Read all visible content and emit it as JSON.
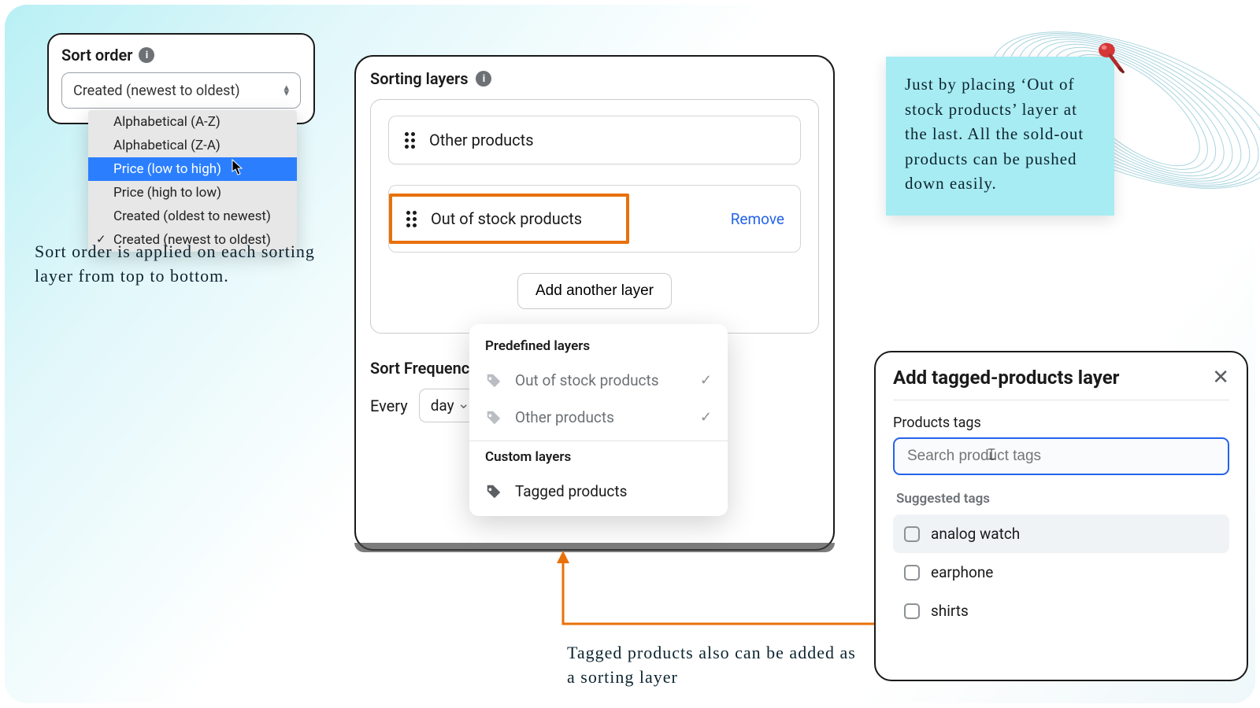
{
  "sort_order": {
    "title": "Sort order",
    "selected": "Created (newest to oldest)",
    "options": [
      {
        "label": "Alphabetical (A-Z)",
        "highlighted": false,
        "checked": false
      },
      {
        "label": "Alphabetical (Z-A)",
        "highlighted": false,
        "checked": false
      },
      {
        "label": "Price (low to high)",
        "highlighted": true,
        "checked": false
      },
      {
        "label": "Price (high to low)",
        "highlighted": false,
        "checked": false
      },
      {
        "label": "Created (oldest to newest)",
        "highlighted": false,
        "checked": false
      },
      {
        "label": "Created (newest to oldest)",
        "highlighted": false,
        "checked": true
      }
    ]
  },
  "annotations": {
    "sort_order": "Sort order is applied on each sorting layer from top to bottom.",
    "tagged": "Tagged products also can be added as a sorting layer",
    "sticky": "Just by placing ‘Out of stock products’ layer at the last. All the sold-out products can be pushed down easily."
  },
  "sorting_layers": {
    "title": "Sorting layers",
    "layers": [
      {
        "name": "Other products"
      },
      {
        "name": "Out of stock products"
      }
    ],
    "remove_label": "Remove",
    "add_button": "Add another layer"
  },
  "sort_frequency": {
    "label": "Sort Frequency",
    "every": "Every",
    "value": "day"
  },
  "popover": {
    "predefined_title": "Predefined layers",
    "predefined": [
      {
        "label": "Out of stock products",
        "added": true
      },
      {
        "label": "Other products",
        "added": true
      }
    ],
    "custom_title": "Custom layers",
    "custom": [
      {
        "label": "Tagged products"
      }
    ]
  },
  "modal": {
    "title": "Add tagged-products layer",
    "field_label": "Products tags",
    "placeholder": "Search product tags",
    "suggested_title": "Suggested tags",
    "tags": [
      {
        "label": "analog watch",
        "highlight": true
      },
      {
        "label": "earphone",
        "highlight": false
      },
      {
        "label": "shirts",
        "highlight": false
      }
    ]
  },
  "colors": {
    "highlight_orange": "#e8710a",
    "link_blue": "#2563eb",
    "sticky_bg": "#a7ecf2"
  }
}
